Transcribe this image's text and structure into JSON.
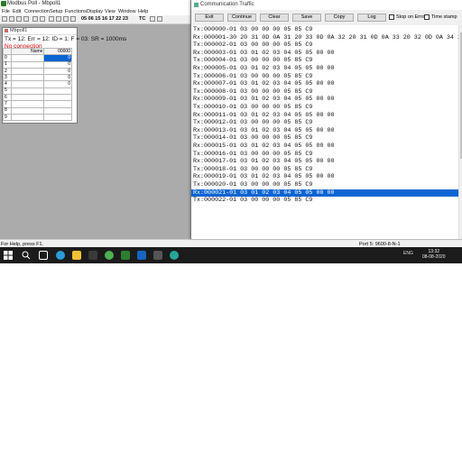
{
  "app": {
    "title": "Modbus Poll - Mbpoll1",
    "menu": [
      "File",
      "Edit",
      "Connection",
      "Setup",
      "Functions",
      "Display",
      "View",
      "Window",
      "Help"
    ],
    "toolbar_function_codes": "05 06 15 16 17 22 23",
    "toolbar_tc": "TC"
  },
  "child_window": {
    "title": "Mbpoll1",
    "status": "Tx = 12: Err = 12: ID = 1: F = 03: SR = 1000ms",
    "connection": "No connection",
    "grid": {
      "headers": [
        "",
        "Name",
        "00000"
      ],
      "rows": [
        {
          "index": "0",
          "name": "",
          "value": "0"
        },
        {
          "index": "1",
          "name": "",
          "value": "0"
        },
        {
          "index": "2",
          "name": "",
          "value": "0"
        },
        {
          "index": "3",
          "name": "",
          "value": "0"
        },
        {
          "index": "4",
          "name": "",
          "value": "0"
        },
        {
          "index": "5",
          "name": "",
          "value": ""
        },
        {
          "index": "6",
          "name": "",
          "value": ""
        },
        {
          "index": "7",
          "name": "",
          "value": ""
        },
        {
          "index": "8",
          "name": "",
          "value": ""
        },
        {
          "index": "9",
          "name": "",
          "value": ""
        }
      ]
    }
  },
  "status_bar": {
    "left": "For Help, press F1.",
    "right": "Port 5: 9600-8-N-1"
  },
  "traffic": {
    "title": "Communication Traffic",
    "buttons": [
      "Exit",
      "Continue",
      "Clear",
      "Save",
      "Copy",
      "Log"
    ],
    "checkboxes": [
      "Stop on Error",
      "Time stamp"
    ],
    "selected_index": 21,
    "lines": [
      "Tx:000000-01 03 00 00 00 05 85 C9",
      "Rx:000001-30 20 31 0D 0A 31 20 33 0D 0A 32 20 31 0D 0A 33 20 32 0D 0A 34 20 33 0D 0A 35",
      "Tx:000002-01 03 00 00 00 05 85 C9",
      "Rx:000003-01 03 01 02 03 04 05 05 00 00",
      "Tx:000004-01 03 00 00 00 05 85 C9",
      "Rx:000005-01 03 01 02 03 04 05 05 00 00",
      "Tx:000006-01 03 00 00 00 05 85 C9",
      "Rx:000007-01 03 01 02 03 04 05 05 00 00",
      "Tx:000008-01 03 00 00 00 05 85 C9",
      "Rx:000009-01 03 01 02 03 04 05 05 00 00",
      "Tx:000010-01 03 00 00 00 05 85 C9",
      "Rx:000011-01 03 01 02 03 04 05 05 00 00",
      "Tx:000012-01 03 00 00 00 05 85 C9",
      "Rx:000013-01 03 01 02 03 04 05 05 00 00",
      "Tx:000014-01 03 00 00 00 05 85 C9",
      "Rx:000015-01 03 01 02 03 04 05 05 00 00",
      "Tx:000016-01 03 00 00 00 05 85 C9",
      "Rx:000017-01 03 01 02 03 04 05 05 00 00",
      "Tx:000018-01 03 00 00 00 05 85 C9",
      "Rx:000019-01 03 01 02 03 04 05 05 00 00",
      "Tx:000020-01 03 00 00 00 05 85 C9",
      "Rx:000021-01 03 01 02 03 04 05 05 00 00",
      "Tx:000022-01 03 00 00 00 05 85 C9"
    ]
  },
  "taskbar": {
    "tray": "ENG",
    "time": "13:32",
    "date": "08-08-2020"
  },
  "colors": {
    "selection": "#0a64d2",
    "error_text": "#d40000",
    "mdi_background": "#ababab",
    "taskbar": "#1b1b1b"
  }
}
